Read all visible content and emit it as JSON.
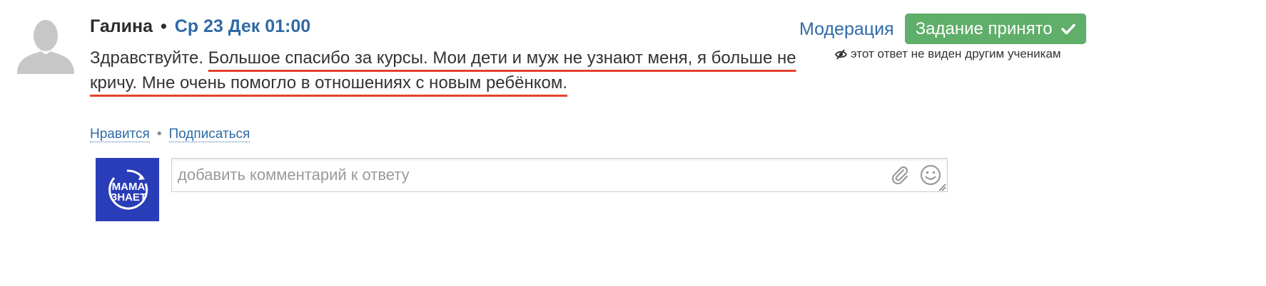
{
  "comment": {
    "author": "Галина",
    "separator": "•",
    "date": "Ср 23 Дек 01:00",
    "text_plain": "Здравствуйте. ",
    "text_underlined": "Большое спасибо за курсы. Мои дети и муж не узнают меня, я больше не кричу. Мне очень помогло в отношениях с новым ребёнком.",
    "underline_color": "#e2422e"
  },
  "moderation": {
    "link_label": "Модерация",
    "status_button_label": "Задание принято",
    "status_icon": "check-icon",
    "status_color": "#5fae69",
    "hidden_note": "этот ответ не виден другим ученикам",
    "hidden_icon": "eye-slash-icon"
  },
  "actions": {
    "like_label": "Нравится",
    "separator": "•",
    "subscribe_label": "Подписаться"
  },
  "reply": {
    "avatar_logo_text_line1": "МАМА",
    "avatar_logo_text_line2": "ЗНАЕТ",
    "avatar_color": "#2a3db8",
    "placeholder": "добавить комментарий к ответу",
    "attach_icon": "paperclip-icon",
    "emoji_icon": "smile-icon"
  },
  "colors": {
    "link": "#2f6aa6",
    "text": "#333333"
  }
}
